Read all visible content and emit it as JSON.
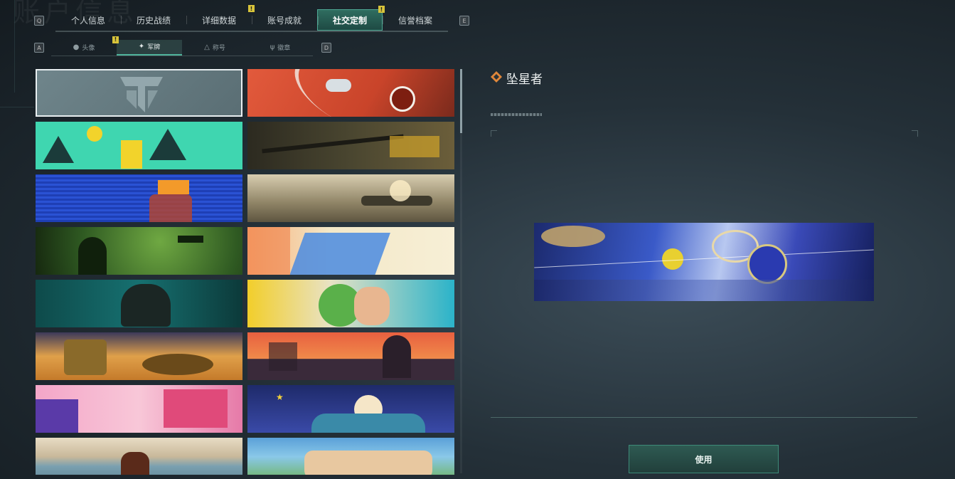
{
  "background_title": "账户信息",
  "tabs": [
    {
      "label": "个人信息",
      "badge": ""
    },
    {
      "label": "历史战绩",
      "badge": ""
    },
    {
      "label": "详细数据",
      "badge": "!"
    },
    {
      "label": "账号成就",
      "badge": ""
    },
    {
      "label": "社交定制",
      "badge": "!",
      "active": true
    },
    {
      "label": "信誉档案",
      "badge": ""
    }
  ],
  "tab_hints": {
    "left": "Q",
    "right": "E"
  },
  "subtabs": [
    {
      "label": "头像",
      "icon": "person-icon"
    },
    {
      "label": "军牌",
      "icon": "dogtag-icon",
      "active": true,
      "badge": "!"
    },
    {
      "label": "称号",
      "icon": "title-icon"
    },
    {
      "label": "徽章",
      "icon": "badge-icon"
    }
  ],
  "subtab_hints": {
    "left": "A",
    "right": "D"
  },
  "selected_item": {
    "name": "坠星者",
    "icon": "diamond-icon"
  },
  "use_button": {
    "label": "使用"
  },
  "colors": {
    "accent": "#4fb39b",
    "badge": "#d8c43a"
  }
}
